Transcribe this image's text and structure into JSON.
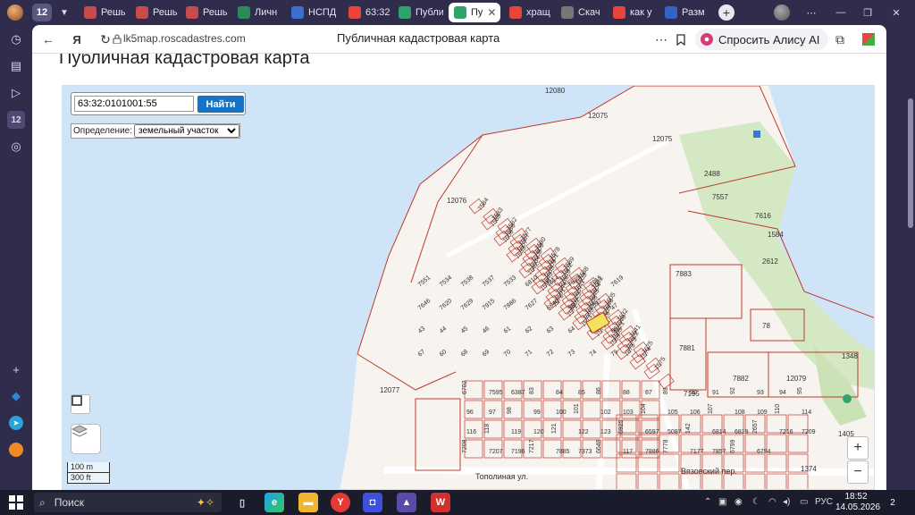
{
  "browser": {
    "tab_counter": "12",
    "tabs": [
      {
        "label": "Решь",
        "icon": "bank-icon",
        "color": "#c84b4b"
      },
      {
        "label": "Решь",
        "icon": "bank-icon",
        "color": "#c84b4b"
      },
      {
        "label": "Решь",
        "icon": "bank-icon",
        "color": "#c84b4b"
      },
      {
        "label": "Личн",
        "icon": "shield-icon",
        "color": "#2a8a5a"
      },
      {
        "label": "НСПД",
        "icon": "nspd-icon",
        "color": "#3b6fd0"
      },
      {
        "label": "63:32",
        "icon": "yandex-icon",
        "color": "#e8443a"
      },
      {
        "label": "Публи",
        "icon": "map-icon",
        "color": "#2fa36b"
      },
      {
        "label": "Пу",
        "icon": "map-icon",
        "color": "#2fa36b",
        "active": true
      },
      {
        "label": "хращ",
        "icon": "yandex-icon",
        "color": "#e8443a"
      },
      {
        "label": "Скач",
        "icon": "doc-icon",
        "color": "#777777"
      },
      {
        "label": "как у",
        "icon": "yandex-icon",
        "color": "#e8443a"
      },
      {
        "label": "Разм",
        "icon": "avito-icon",
        "color": "#3064c8"
      }
    ],
    "url": "lk5map.roscadastres.com",
    "page_title": "Публичная кадастровая карта",
    "alice_label": "Спросить Алису AI",
    "accent": "#d43c7a"
  },
  "page": {
    "heading": "Публичная кадастровая карта"
  },
  "map": {
    "search_value": "63:32:0101001:55",
    "find_label": "Найти",
    "definition_label": "Определение:",
    "definition_value": "земельный участок",
    "scale_m": "100 m",
    "scale_ft": "300 ft",
    "zoom_in": "+",
    "zoom_out": "−",
    "water_color": "#cfe4f6",
    "parcel_color": "#c0392b",
    "street_labels": [
      "Тополиная ул.",
      "Вязовский пер."
    ],
    "parcel_labels": [
      "12080",
      "12075",
      "12075",
      "12076",
      "12077",
      "12079",
      "7883",
      "7881",
      "7882",
      "2612",
      "1584",
      "2488",
      "7557",
      "7616",
      "1348",
      "78",
      "7195",
      "1405",
      "1374",
      "7584",
      "7583",
      "7582",
      "7577",
      "7580",
      "7578",
      "7589",
      "7588",
      "7581",
      "7585",
      "7586",
      "7587",
      "7600",
      "7601",
      "7602",
      "7603",
      "7604",
      "7605",
      "7606",
      "7607",
      "7608",
      "7609",
      "7610",
      "7611",
      "7645",
      "7646",
      "7632",
      "7633",
      "7634",
      "7635",
      "7636",
      "7637",
      "7638",
      "7639",
      "7640",
      "7641",
      "7642",
      "7643",
      "7644",
      "7623",
      "7624",
      "7626",
      "7621",
      "7622",
      "7625",
      "7590",
      "7591",
      "7592",
      "7593",
      "7594",
      "7595",
      "7573",
      "7574",
      "7575",
      "7576",
      "7572",
      "7571",
      "7570",
      "7569",
      "7873",
      "7551",
      "7534",
      "7538",
      "7537",
      "7533",
      "6810",
      "7614",
      "7539",
      "7615",
      "7619",
      "7646",
      "7620",
      "7629",
      "7915",
      "7886",
      "7627",
      "6840",
      "55",
      "7597",
      "47",
      "43",
      "44",
      "45",
      "46",
      "61",
      "62",
      "63",
      "64",
      "65",
      "66",
      "67",
      "60",
      "68",
      "69",
      "70",
      "71",
      "72",
      "73",
      "74",
      "75",
      "6702",
      "7595",
      "6387",
      "83",
      "84",
      "85",
      "86",
      "88",
      "87",
      "89",
      "90",
      "91",
      "92",
      "93",
      "94",
      "95",
      "96",
      "97",
      "98",
      "99",
      "100",
      "101",
      "102",
      "103",
      "104",
      "105",
      "106",
      "107",
      "108",
      "109",
      "110",
      "114",
      "116",
      "118",
      "119",
      "120",
      "121",
      "122",
      "123",
      "6925",
      "6597",
      "5087",
      "142",
      "6814",
      "6819",
      "2657",
      "7216",
      "7209",
      "7208",
      "7207",
      "7196",
      "7217",
      "7885",
      "7373",
      "6648",
      "117",
      "7886",
      "7778",
      "7177",
      "7857",
      "6799",
      "6794"
    ]
  },
  "taskbar": {
    "search_label": "Поиск",
    "lang": "РУС",
    "time": "18:52",
    "date": "14.05.2026",
    "notifications": "2"
  }
}
